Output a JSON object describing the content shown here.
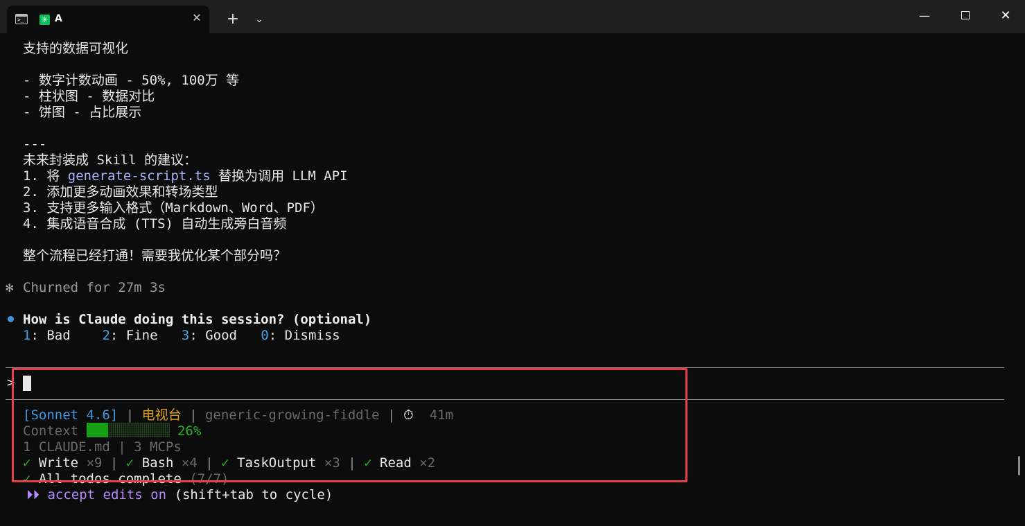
{
  "window": {
    "tab_icon": "terminal-icon",
    "tab_title": "A",
    "app_icon_glyph": "✳",
    "tab_close_glyph": "✕",
    "new_tab_glyph": "+",
    "dropdown_glyph": "⌄",
    "minimize_glyph": "—",
    "close_glyph": "✕"
  },
  "transcript": {
    "heading": "支持的数据可视化",
    "bullets": [
      "- 数字计数动画 - 50%, 100万 等",
      "- 柱状图 - 数据对比",
      "- 饼图 - 占比展示"
    ],
    "separator": "---",
    "suggest_title": "未来封装成 Skill 的建议：",
    "item1_prefix": "1. 将 ",
    "item1_code": "generate-script.ts",
    "item1_suffix": " 替换为调用 LLM API",
    "item2": "2. 添加更多动画效果和转场类型",
    "item3": "3. 支持更多输入格式（Markdown、Word、PDF）",
    "item4": "4. 集成语音合成 (TTS) 自动生成旁白音频",
    "closing": "整个流程已经打通！需要我优化某个部分吗？"
  },
  "status_line": {
    "spinner_glyph": "✻",
    "text": "Churned for 27m 3s"
  },
  "feedback": {
    "question": "How is Claude doing this session? (optional)",
    "options": [
      {
        "key": "1",
        "label": "Bad"
      },
      {
        "key": "2",
        "label": "Fine"
      },
      {
        "key": "3",
        "label": "Good"
      },
      {
        "key": "0",
        "label": "Dismiss"
      }
    ]
  },
  "input": {
    "prompt_glyph": ">",
    "value": ""
  },
  "statusbar": {
    "model_open": "[",
    "model": "Sonnet 4.6",
    "model_close": "]",
    "sep": " | ",
    "project": "电视台",
    "branch": "generic-growing-fiddle",
    "timer_icon": "⏱",
    "elapsed": "41m",
    "context_label": "Context",
    "context_fraction": 0.26,
    "context_percent": "26%",
    "config_info": "1 CLAUDE.md | 3 MCPs",
    "tools": [
      {
        "check": "✓",
        "name": "Write",
        "count": "×9"
      },
      {
        "check": "✓",
        "name": "Bash",
        "count": "×4"
      },
      {
        "check": "✓",
        "name": "TaskOutput",
        "count": "×3"
      },
      {
        "check": "✓",
        "name": "Read",
        "count": "×2"
      }
    ],
    "todos_check": "✓",
    "todos_text": "All todos complete",
    "todos_count": "(7/7)",
    "mode_glyph": "⏵⏵",
    "mode_text": "accept edits on",
    "mode_hint": "(shift+tab to cycle)"
  }
}
